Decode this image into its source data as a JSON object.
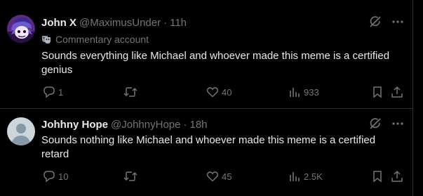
{
  "posts": [
    {
      "author_name": "John X",
      "handle": "@MaximusUnder",
      "separator": "·",
      "time": "11h",
      "account_label": "Commentary account",
      "text": "Sounds everything like Michael and whoever made this meme is a certified genius",
      "replies": "1",
      "reposts": "",
      "likes": "40",
      "views": "933",
      "avatar_icon": "cartoon-avatar"
    },
    {
      "author_name": "Johhny Hope",
      "handle": "@JohhnyHope",
      "separator": "·",
      "time": "18h",
      "text": "Sounds nothing like Michael and whoever made this meme is a certified retard",
      "replies": "10",
      "reposts": "",
      "likes": "45",
      "views": "2.5K",
      "avatar_icon": "default-avatar"
    }
  ],
  "colors": {
    "background": "#000000",
    "text": "#e7e9ea",
    "muted": "#71767b",
    "divider": "#2f3336"
  }
}
